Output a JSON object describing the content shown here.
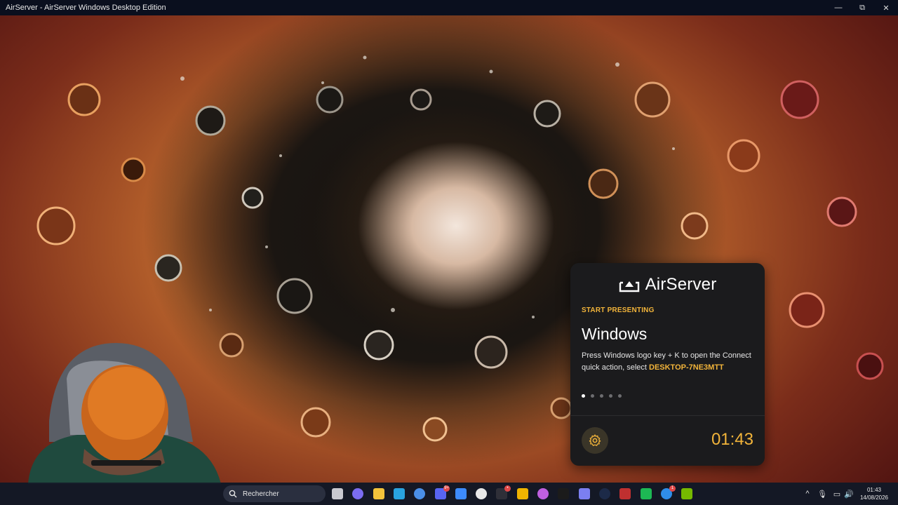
{
  "window": {
    "title": "AirServer - AirServer Windows Desktop Edition",
    "controls": {
      "minimize": "—",
      "maximize": "⧉",
      "close": "✕"
    }
  },
  "card": {
    "logo_text": "AirServer",
    "eyebrow": "START PRESENTING",
    "headline": "Windows",
    "description": "Press Windows logo key + K to open the Connect quick action, select ",
    "device_name": "DESKTOP-7NE3MTT",
    "page_dots": {
      "count": 5,
      "active": 1
    },
    "timer": "01:43",
    "accent_color": "#f2b43a"
  },
  "taskbar": {
    "search_placeholder": "Rechercher",
    "apps": [
      {
        "name": "task-view",
        "color": "#c9c9d0"
      },
      {
        "name": "copilot",
        "color": "#7b6cf0"
      },
      {
        "name": "file-explorer",
        "color": "#f3c33b"
      },
      {
        "name": "edge",
        "color": "#29a3e0"
      },
      {
        "name": "microsoft-store",
        "color": "#4a8fe8"
      },
      {
        "name": "discord",
        "color": "#5865f2",
        "badge": "9+"
      },
      {
        "name": "mail",
        "color": "#3d8bfd"
      },
      {
        "name": "airserver",
        "color": "#e8e8e8"
      },
      {
        "name": "obs",
        "color": "#2f2f38",
        "badge": "•"
      },
      {
        "name": "chrome",
        "color": "#f0b400"
      },
      {
        "name": "game-app",
        "color": "#c060e0"
      },
      {
        "name": "nvidia-app",
        "color": "#1b1b1b"
      },
      {
        "name": "voice-app",
        "color": "#7b7ff0"
      },
      {
        "name": "steam",
        "color": "#1c2a48"
      },
      {
        "name": "voicemeeter",
        "color": "#c03030"
      },
      {
        "name": "spotify",
        "color": "#1db954"
      },
      {
        "name": "app-store",
        "color": "#2f8de8",
        "badge": "1"
      },
      {
        "name": "nvidia-overlay",
        "color": "#76b900"
      }
    ],
    "tray": {
      "chevron": "^",
      "mic": "🎙",
      "display": "▭",
      "volume": "🔊"
    },
    "time": "01:43",
    "date": "14/08/2026"
  }
}
